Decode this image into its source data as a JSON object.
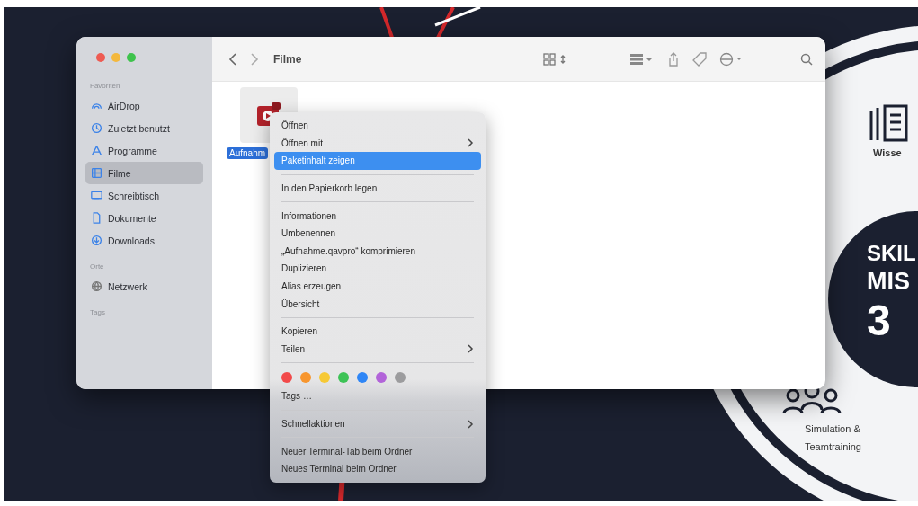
{
  "window": {
    "title": "Filme"
  },
  "sidebar": {
    "sections": [
      {
        "heading": "Favoriten",
        "items": [
          {
            "label": "AirDrop",
            "selected": false
          },
          {
            "label": "Zuletzt benutzt",
            "selected": false
          },
          {
            "label": "Programme",
            "selected": false
          },
          {
            "label": "Filme",
            "selected": true
          },
          {
            "label": "Schreibtisch",
            "selected": false
          },
          {
            "label": "Dokumente",
            "selected": false
          },
          {
            "label": "Downloads",
            "selected": false
          }
        ]
      },
      {
        "heading": "Orte",
        "items": [
          {
            "label": "Netzwerk",
            "selected": false
          }
        ]
      },
      {
        "heading": "Tags"
      }
    ]
  },
  "file": {
    "name": "Aufnahm",
    "selected": true
  },
  "context_menu": [
    {
      "kind": "item",
      "label": "Öffnen",
      "submenu": false,
      "selected": false
    },
    {
      "kind": "item",
      "label": "Öffnen mit",
      "submenu": true,
      "selected": false
    },
    {
      "kind": "item",
      "label": "Paketinhalt zeigen",
      "submenu": false,
      "selected": true
    },
    {
      "kind": "separator"
    },
    {
      "kind": "item",
      "label": "In den Papierkorb legen",
      "submenu": false,
      "selected": false
    },
    {
      "kind": "separator"
    },
    {
      "kind": "item",
      "label": "Informationen",
      "submenu": false,
      "selected": false
    },
    {
      "kind": "item",
      "label": "Umbenennen",
      "submenu": false,
      "selected": false
    },
    {
      "kind": "item",
      "label": "„Aufnahme.qavpro“ komprimieren",
      "submenu": false,
      "selected": false
    },
    {
      "kind": "item",
      "label": "Duplizieren",
      "submenu": false,
      "selected": false
    },
    {
      "kind": "item",
      "label": "Alias erzeugen",
      "submenu": false,
      "selected": false
    },
    {
      "kind": "item",
      "label": "Übersicht",
      "submenu": false,
      "selected": false
    },
    {
      "kind": "separator"
    },
    {
      "kind": "item",
      "label": "Kopieren",
      "submenu": false,
      "selected": false
    },
    {
      "kind": "item",
      "label": "Teilen",
      "submenu": true,
      "selected": false
    },
    {
      "kind": "separator"
    },
    {
      "kind": "tags",
      "colors": [
        {
          "color": "#f24a4a"
        },
        {
          "color": "#f7962e"
        },
        {
          "color": "#f6c935"
        },
        {
          "color": "#3dc356"
        },
        {
          "color": "#2f86f6"
        },
        {
          "color": "#b264d9"
        },
        {
          "color": "#9c9c9e"
        }
      ]
    },
    {
      "kind": "item",
      "label": "Tags …",
      "submenu": false,
      "selected": false
    },
    {
      "kind": "separator"
    },
    {
      "kind": "item",
      "label": "Schnellaktionen",
      "submenu": true,
      "selected": false
    },
    {
      "kind": "separator"
    },
    {
      "kind": "item",
      "label": "Neuer Terminal-Tab beim Ordner",
      "submenu": false,
      "selected": false
    },
    {
      "kind": "item",
      "label": "Neues Terminal beim Ordner",
      "submenu": false,
      "selected": false
    }
  ],
  "wallpaper": {
    "top_label": "Wisse",
    "logo_lines": [
      "SKIL",
      "MIS",
      "3"
    ],
    "bottom_label_lines": [
      "Simulation &",
      "Teamtraining"
    ]
  }
}
